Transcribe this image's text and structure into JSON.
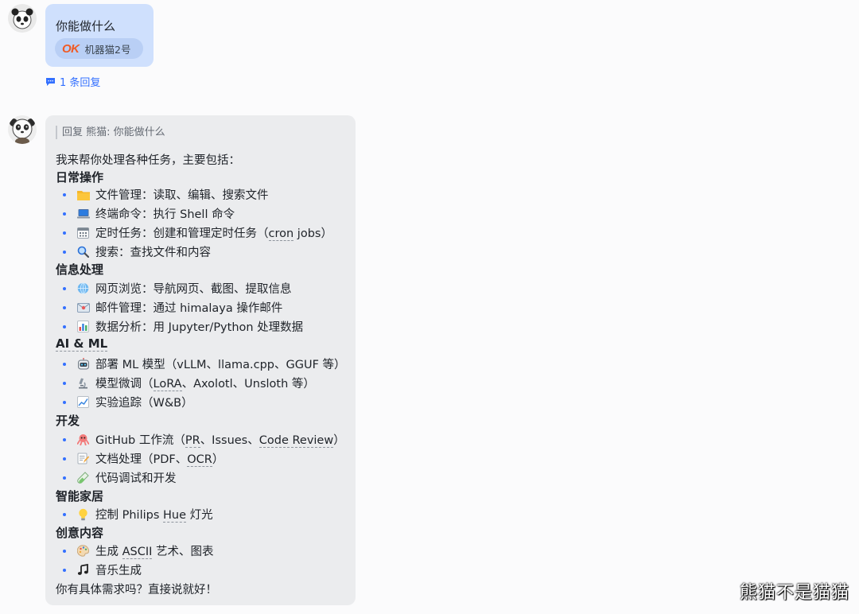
{
  "message1": {
    "text": "你能做什么",
    "reaction": {
      "emoji_text": "OK",
      "user": "机器猫2号"
    },
    "reply_count_text": "1 条回复"
  },
  "message2": {
    "quote": "回复 熊猫: 你能做什么",
    "intro": "我来帮你处理各种任务，主要包括：",
    "sections": [
      {
        "title": "日常操作",
        "items": [
          {
            "icon": "folder-icon",
            "text": "文件管理：读取、编辑、搜索文件"
          },
          {
            "icon": "laptop-icon",
            "text": "终端命令：执行 Shell 命令"
          },
          {
            "icon": "calendar-icon",
            "text": "定时任务：创建和管理定时任务（cron jobs）"
          },
          {
            "icon": "magnifier-icon",
            "text": "搜索：查找文件和内容"
          }
        ]
      },
      {
        "title": "信息处理",
        "items": [
          {
            "icon": "globe-icon",
            "text": "网页浏览：导航网页、截图、提取信息"
          },
          {
            "icon": "email-icon",
            "text": "邮件管理：通过 himalaya 操作邮件"
          },
          {
            "icon": "bar-chart-icon",
            "text": "数据分析：用 Jupyter/Python 处理数据"
          }
        ]
      },
      {
        "title": "AI & ML",
        "items": [
          {
            "icon": "robot-icon",
            "text": "部署 ML 模型（vLLM、llama.cpp、GGUF 等）"
          },
          {
            "icon": "microscope-icon",
            "text": "模型微调（LoRA、Axolotl、Unsloth 等）"
          },
          {
            "icon": "line-chart-icon",
            "text": "实验追踪（W&B）"
          }
        ]
      },
      {
        "title": "开发",
        "items": [
          {
            "icon": "octopus-icon",
            "text": "GitHub 工作流（PR、Issues、Code Review）"
          },
          {
            "icon": "memo-icon",
            "text": "文档处理（PDF、OCR）"
          },
          {
            "icon": "test-tube-icon",
            "text": "代码调试和开发"
          }
        ]
      },
      {
        "title": "智能家居",
        "items": [
          {
            "icon": "light-bulb-icon",
            "text": "控制 Philips Hue 灯光"
          }
        ]
      },
      {
        "title": "创意内容",
        "items": [
          {
            "icon": "palette-icon",
            "text": "生成 ASCII 艺术、图表"
          },
          {
            "icon": "music-note-icon",
            "text": "音乐生成"
          }
        ]
      }
    ],
    "outro": "你有具体需求吗？直接说就好！"
  },
  "watermark": "熊猫不是猫猫",
  "colors": {
    "accent": "#3370ff",
    "bubble_user": "#cfe0fd",
    "bubble_bot": "#ebecee"
  }
}
